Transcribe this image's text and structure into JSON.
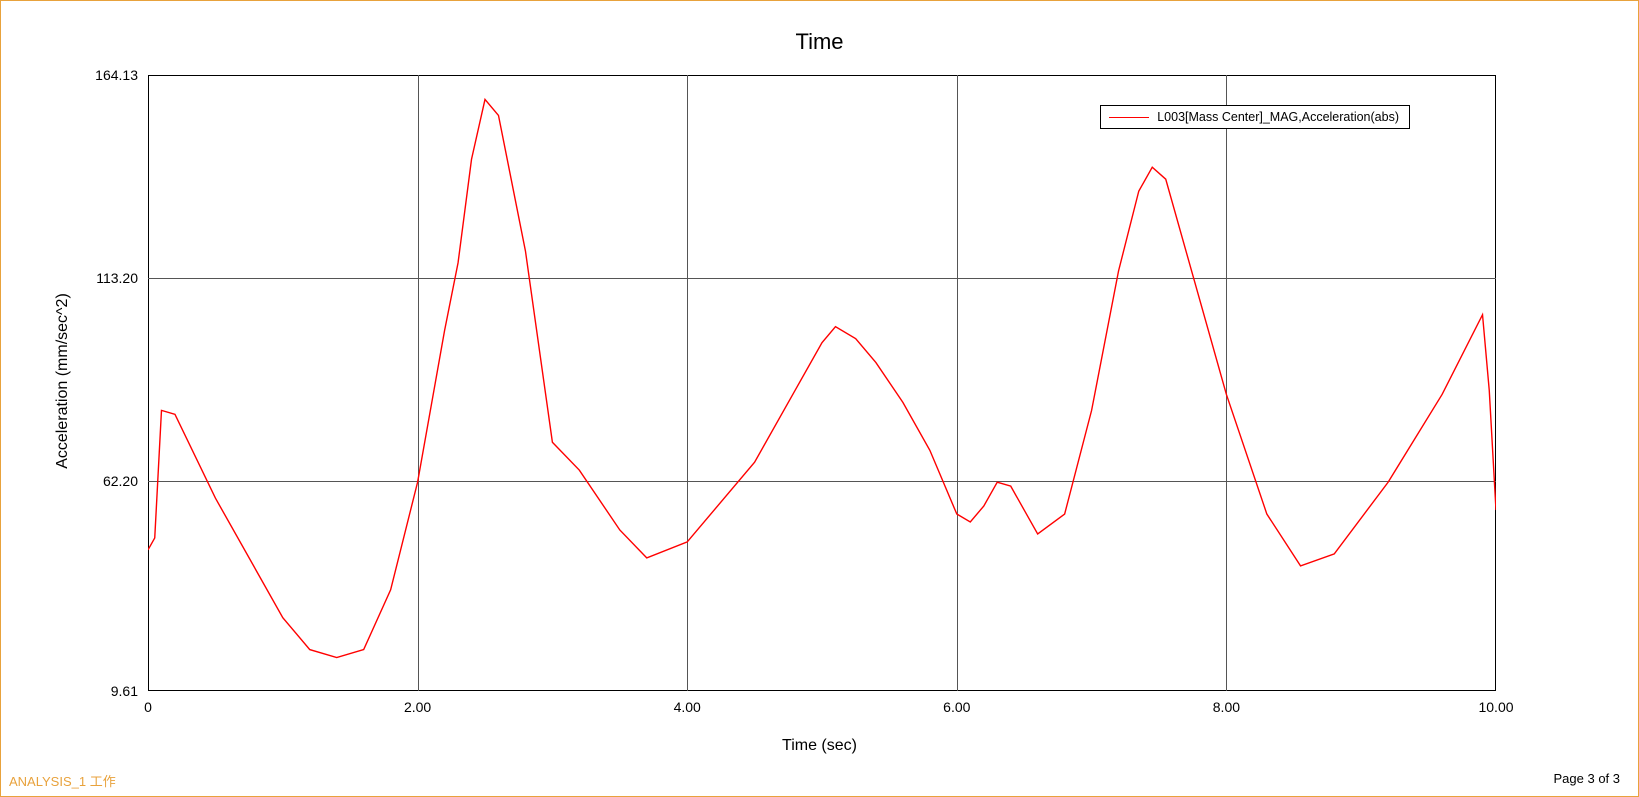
{
  "title": "Time",
  "xlabel": "Time (sec)",
  "ylabel": "Acceleration (mm/sec^2)",
  "footer_left": "ANALYSIS_1 工作",
  "footer_right": "Page 3 of 3",
  "legend": {
    "label": "L003[Mass Center]_MAG,Acceleration(abs)"
  },
  "yticks": [
    "9.61",
    "62.20",
    "113.20",
    "164.13"
  ],
  "xticks": [
    "0",
    "2.00",
    "4.00",
    "6.00",
    "8.00",
    "10.00"
  ],
  "chart_data": {
    "type": "line",
    "title": "Time",
    "xlabel": "Time (sec)",
    "ylabel": "Acceleration (mm/sec^2)",
    "xlim": [
      0,
      10
    ],
    "ylim": [
      9.61,
      164.13
    ],
    "legend_position": "top-right-inside",
    "grid": true,
    "series": [
      {
        "name": "L003[Mass Center]_MAG,Acceleration(abs)",
        "color": "#ff0000",
        "x": [
          0.0,
          0.05,
          0.1,
          0.2,
          0.5,
          0.8,
          1.0,
          1.2,
          1.4,
          1.6,
          1.8,
          2.0,
          2.2,
          2.3,
          2.4,
          2.5,
          2.6,
          2.8,
          3.0,
          3.2,
          3.5,
          3.7,
          4.0,
          4.5,
          4.8,
          5.0,
          5.1,
          5.25,
          5.4,
          5.6,
          5.8,
          6.0,
          6.1,
          6.2,
          6.3,
          6.4,
          6.5,
          6.6,
          6.8,
          7.0,
          7.2,
          7.35,
          7.45,
          7.55,
          7.7,
          8.0,
          8.3,
          8.55,
          8.8,
          9.2,
          9.6,
          9.9,
          9.95,
          10.0
        ],
        "values": [
          45.0,
          48.0,
          80.0,
          79.0,
          58.0,
          40.0,
          28.0,
          20.0,
          18.0,
          20.0,
          35.0,
          62.0,
          100.0,
          117.0,
          143.0,
          158.0,
          154.0,
          120.0,
          72.0,
          65.0,
          50.0,
          43.0,
          47.0,
          67.0,
          85.0,
          97.0,
          101.0,
          98.0,
          92.0,
          82.0,
          70.0,
          54.0,
          52.0,
          56.0,
          62.0,
          61.0,
          55.0,
          49.0,
          54.0,
          80.0,
          115.0,
          135.0,
          141.0,
          138.0,
          120.0,
          84.0,
          54.0,
          41.0,
          44.0,
          62.0,
          84.0,
          104.0,
          85.0,
          55.0
        ]
      }
    ]
  }
}
